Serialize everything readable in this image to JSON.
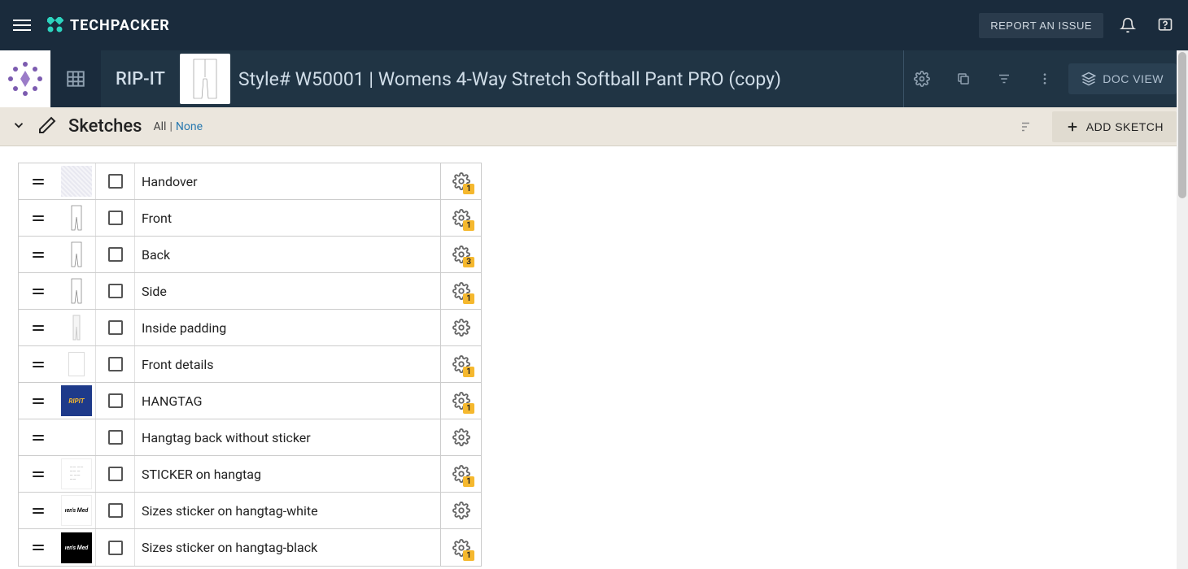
{
  "app": {
    "name": "TECHPACKER"
  },
  "topbar": {
    "report_btn": "REPORT AN ISSUE"
  },
  "subbar": {
    "brand_label": "RIP-IT",
    "style_title": "Style# W50001 | Womens 4-Way Stretch Softball Pant PRO (copy)",
    "doc_view": "DOC VIEW"
  },
  "section": {
    "title": "Sketches",
    "all_label": "All",
    "none_label": "None",
    "add_sketch": "ADD SKETCH"
  },
  "rows": [
    {
      "name": "Handover",
      "thumb": "noise",
      "badge": "1"
    },
    {
      "name": "Front",
      "thumb": "pant-front",
      "badge": "1"
    },
    {
      "name": "Back",
      "thumb": "pant-back",
      "badge": "3"
    },
    {
      "name": "Side",
      "thumb": "pant-side",
      "badge": "1"
    },
    {
      "name": "Inside padding",
      "thumb": "pant-pad",
      "badge": null
    },
    {
      "name": "Front details",
      "thumb": "label",
      "badge": "1"
    },
    {
      "name": "HANGTAG",
      "thumb": "blue",
      "thumb_text": "RIPIT",
      "badge": "1"
    },
    {
      "name": "Hangtag back without sticker",
      "thumb": "blank",
      "badge": null
    },
    {
      "name": "STICKER on hangtag",
      "thumb": "doc",
      "badge": "1"
    },
    {
      "name": "Sizes sticker on hangtag-white",
      "thumb": "white-txt",
      "thumb_text": "ıen's Med",
      "badge": null
    },
    {
      "name": "Sizes sticker on hangtag-black",
      "thumb": "black",
      "thumb_text": "ıen's Med",
      "badge": "1"
    }
  ]
}
